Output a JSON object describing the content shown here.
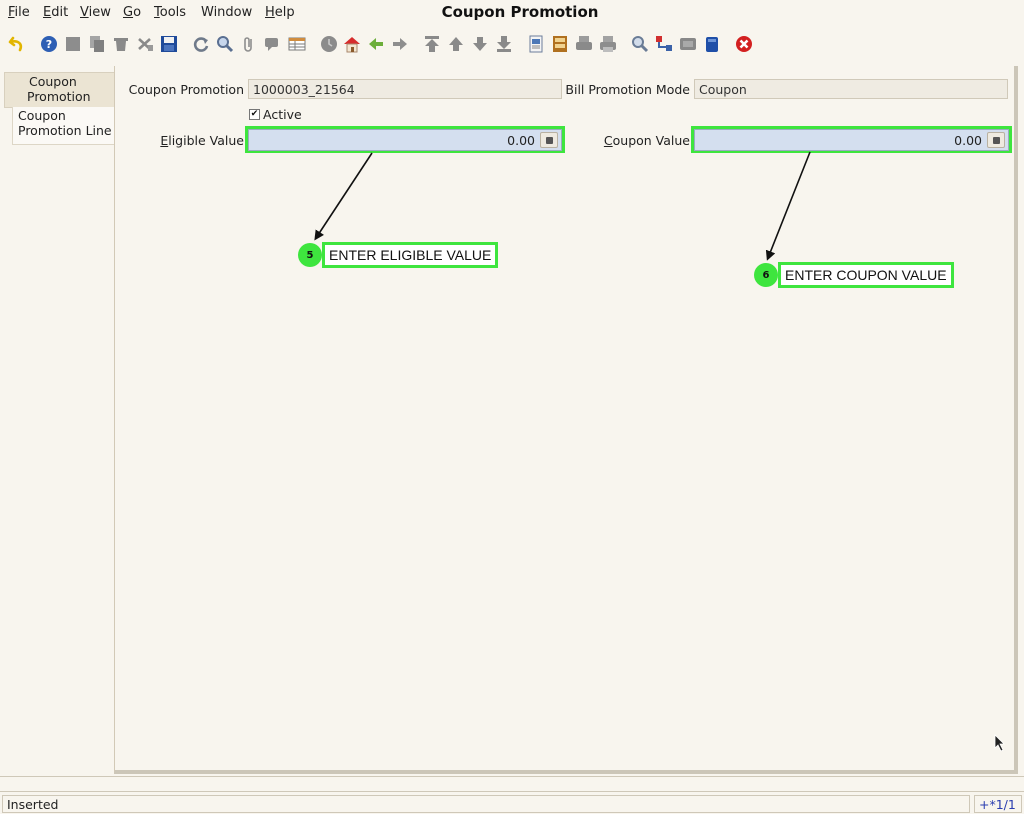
{
  "window": {
    "title": "Coupon Promotion"
  },
  "menu": [
    {
      "mnemonic": "F",
      "rest": "ile"
    },
    {
      "mnemonic": "E",
      "rest": "dit"
    },
    {
      "mnemonic": "V",
      "rest": "iew"
    },
    {
      "mnemonic": "G",
      "rest": "o"
    },
    {
      "mnemonic": "T",
      "rest": "ools"
    },
    {
      "mnemonic": "",
      "rest": "Window"
    },
    {
      "mnemonic": "H",
      "rest": "elp"
    }
  ],
  "toolbar": {
    "icons": [
      "undo-icon",
      "help-icon",
      "new-icon",
      "copy-icon",
      "delete-icon",
      "delete-selection-icon",
      "save-icon",
      "refresh-icon",
      "find-icon",
      "attachment-icon",
      "chat-icon",
      "grid-toggle-icon",
      "history-icon",
      "home-icon",
      "parent-icon",
      "detail-icon",
      "first-record-icon",
      "previous-record-icon",
      "next-record-icon",
      "last-record-icon",
      "report-icon",
      "archive-icon",
      "print-preview-icon",
      "print-icon",
      "zoom-across-icon",
      "workflow-icon",
      "request-icon",
      "product-info-icon",
      "close-window-icon"
    ]
  },
  "tabs": [
    {
      "label_line1": "Coupon",
      "label_line2": "Promotion",
      "selected": true
    },
    {
      "label_line1": "Coupon",
      "label_line2": "Promotion Line",
      "selected": false
    }
  ],
  "form": {
    "coupon_promotion_label": "Coupon Promotion",
    "coupon_promotion_value": "1000003_21564",
    "bill_promotion_mode_label": "Bill Promotion Mode",
    "bill_promotion_mode_value": "Coupon",
    "active_label": "Active",
    "active_checked": "✔",
    "eligible_value_mnemonic": "E",
    "eligible_value_label_rest": "ligible Value",
    "eligible_value": "0.00",
    "coupon_value_mnemonic": "C",
    "coupon_value_label_rest": "oupon Value",
    "coupon_value": "0.00"
  },
  "annotations": [
    {
      "step": "5",
      "text": "ENTER ELIGIBLE VALUE"
    },
    {
      "step": "6",
      "text": "ENTER COUPON VALUE"
    }
  ],
  "status": {
    "message": "Inserted",
    "record_info": "+*1/1"
  },
  "colors": {
    "highlight": "#3ee53e",
    "field_background": "#d4dfef",
    "record_info_text": "#2a3db0"
  }
}
